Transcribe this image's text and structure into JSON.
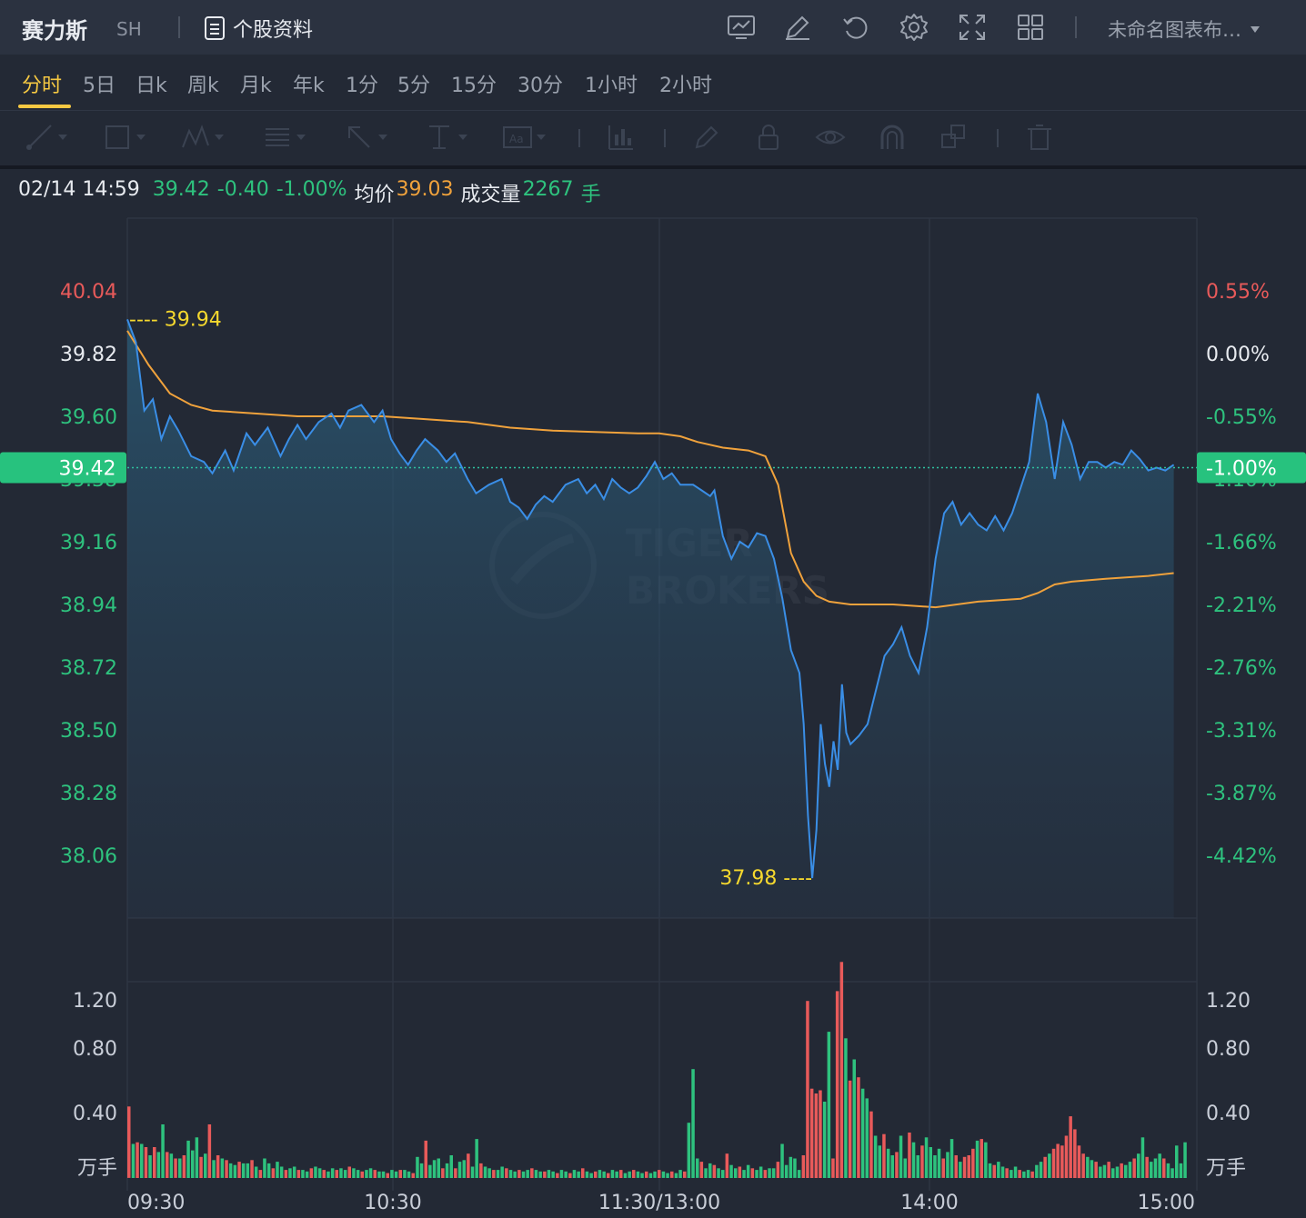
{
  "header": {
    "stock_name": "赛力斯",
    "market": "SH",
    "profile_label": "个股资料",
    "layout_name": "未命名图表布…",
    "icons": [
      "chart-settings-icon",
      "edit-icon",
      "refresh-icon",
      "gear-icon",
      "fullscreen-icon",
      "grid-layout-icon"
    ]
  },
  "periods": [
    "分时",
    "5日",
    "日k",
    "周k",
    "月k",
    "年k",
    "1分",
    "5分",
    "15分",
    "30分",
    "1小时",
    "2小时"
  ],
  "active_period": "分时",
  "drawing_tools": [
    "line-tool-icon",
    "rectangle-tool-icon",
    "pattern-tool-icon",
    "fib-tool-icon",
    "arrow-tool-icon",
    "text-tool-icon",
    "annotation-tool-icon",
    "indicator-icon",
    "brush-icon",
    "lock-icon",
    "eye-icon",
    "magnet-icon",
    "layers-icon",
    "trash-icon"
  ],
  "info": {
    "datetime": "02/14 14:59",
    "price": "39.42",
    "change": "-0.40",
    "change_pct": "-1.00%",
    "avg_label": "均价",
    "avg_value": "39.03",
    "volume_label": "成交量",
    "volume_value": "2267",
    "volume_unit": "手"
  },
  "colors": {
    "up": "#e85a5a",
    "down": "#2ec27e",
    "price_line": "#3a8ee6",
    "avg_line": "#f0a23c",
    "marker": "#f5d82e",
    "background": "#232935"
  },
  "chart_data": {
    "type": "line",
    "x_ticks": [
      "09:30",
      "10:30",
      "11:30/13:00",
      "14:00",
      "15:00"
    ],
    "y_ticks_left": [
      "40.04",
      "39.82",
      "39.60",
      "39.38",
      "39.16",
      "38.94",
      "38.72",
      "38.50",
      "38.28",
      "38.06"
    ],
    "y_ticks_right": [
      "0.55%",
      "0.00%",
      "-0.55%",
      "-1.10%",
      "-1.66%",
      "-2.21%",
      "-2.76%",
      "-3.31%",
      "-3.87%",
      "-4.42%"
    ],
    "ylim": [
      37.8,
      40.3
    ],
    "prev_close": 39.82,
    "current_price": 39.42,
    "current_price_label": "39.42",
    "current_pct_label": "-1.00%",
    "high_label": "39.94",
    "low_label": "37.98",
    "high": 39.94,
    "low": 37.98,
    "price_series": [
      [
        0,
        39.94
      ],
      [
        2,
        39.86
      ],
      [
        4,
        39.62
      ],
      [
        6,
        39.66
      ],
      [
        8,
        39.52
      ],
      [
        10,
        39.6
      ],
      [
        12,
        39.55
      ],
      [
        15,
        39.46
      ],
      [
        18,
        39.44
      ],
      [
        20,
        39.4
      ],
      [
        23,
        39.48
      ],
      [
        25,
        39.41
      ],
      [
        28,
        39.54
      ],
      [
        30,
        39.5
      ],
      [
        33,
        39.56
      ],
      [
        36,
        39.46
      ],
      [
        38,
        39.52
      ],
      [
        40,
        39.57
      ],
      [
        42,
        39.52
      ],
      [
        45,
        39.58
      ],
      [
        48,
        39.61
      ],
      [
        50,
        39.56
      ],
      [
        52,
        39.62
      ],
      [
        55,
        39.64
      ],
      [
        58,
        39.58
      ],
      [
        60,
        39.62
      ],
      [
        62,
        39.52
      ],
      [
        64,
        39.47
      ],
      [
        66,
        39.43
      ],
      [
        68,
        39.48
      ],
      [
        70,
        39.52
      ],
      [
        73,
        39.48
      ],
      [
        75,
        39.44
      ],
      [
        77,
        39.47
      ],
      [
        80,
        39.38
      ],
      [
        82,
        39.33
      ],
      [
        85,
        39.36
      ],
      [
        88,
        39.38
      ],
      [
        90,
        39.3
      ],
      [
        92,
        39.28
      ],
      [
        94,
        39.24
      ],
      [
        96,
        39.29
      ],
      [
        98,
        39.32
      ],
      [
        100,
        39.3
      ],
      [
        103,
        39.36
      ],
      [
        106,
        39.38
      ],
      [
        108,
        39.33
      ],
      [
        110,
        39.36
      ],
      [
        112,
        39.31
      ],
      [
        114,
        39.38
      ],
      [
        116,
        39.35
      ],
      [
        118,
        39.33
      ],
      [
        120,
        39.35
      ],
      [
        122,
        39.39
      ],
      [
        124,
        39.44
      ],
      [
        126,
        39.38
      ],
      [
        128,
        39.4
      ],
      [
        130,
        39.36
      ],
      [
        133,
        39.36
      ],
      [
        135,
        39.34
      ],
      [
        137,
        39.32
      ],
      [
        138,
        39.34
      ],
      [
        140,
        39.18
      ],
      [
        142,
        39.1
      ],
      [
        144,
        39.16
      ],
      [
        146,
        39.14
      ],
      [
        148,
        39.19
      ],
      [
        150,
        39.18
      ],
      [
        152,
        39.1
      ],
      [
        154,
        38.96
      ],
      [
        156,
        38.78
      ],
      [
        158,
        38.7
      ],
      [
        159,
        38.52
      ],
      [
        160,
        38.2
      ],
      [
        161,
        37.98
      ],
      [
        162,
        38.15
      ],
      [
        163,
        38.52
      ],
      [
        164,
        38.38
      ],
      [
        165,
        38.3
      ],
      [
        166,
        38.46
      ],
      [
        167,
        38.36
      ],
      [
        168,
        38.66
      ],
      [
        169,
        38.49
      ],
      [
        170,
        38.45
      ],
      [
        172,
        38.48
      ],
      [
        174,
        38.52
      ],
      [
        176,
        38.64
      ],
      [
        178,
        38.76
      ],
      [
        180,
        38.8
      ],
      [
        182,
        38.86
      ],
      [
        184,
        38.76
      ],
      [
        186,
        38.7
      ],
      [
        188,
        38.86
      ],
      [
        190,
        39.1
      ],
      [
        192,
        39.26
      ],
      [
        194,
        39.3
      ],
      [
        196,
        39.22
      ],
      [
        198,
        39.26
      ],
      [
        200,
        39.22
      ],
      [
        202,
        39.2
      ],
      [
        204,
        39.25
      ],
      [
        206,
        39.2
      ],
      [
        208,
        39.26
      ],
      [
        210,
        39.35
      ],
      [
        212,
        39.44
      ],
      [
        214,
        39.68
      ],
      [
        216,
        39.58
      ],
      [
        218,
        39.38
      ],
      [
        220,
        39.58
      ],
      [
        222,
        39.5
      ],
      [
        224,
        39.38
      ],
      [
        226,
        39.44
      ],
      [
        228,
        39.44
      ],
      [
        230,
        39.42
      ],
      [
        232,
        39.44
      ],
      [
        234,
        39.43
      ],
      [
        236,
        39.48
      ],
      [
        238,
        39.45
      ],
      [
        240,
        39.41
      ],
      [
        242,
        39.42
      ],
      [
        244,
        39.41
      ],
      [
        246,
        39.43
      ],
      [
        240,
        39.42
      ]
    ],
    "avg_series": [
      [
        0,
        39.9
      ],
      [
        5,
        39.78
      ],
      [
        10,
        39.68
      ],
      [
        15,
        39.64
      ],
      [
        20,
        39.62
      ],
      [
        30,
        39.61
      ],
      [
        40,
        39.6
      ],
      [
        60,
        39.6
      ],
      [
        70,
        39.59
      ],
      [
        80,
        39.58
      ],
      [
        90,
        39.56
      ],
      [
        100,
        39.55
      ],
      [
        120,
        39.54
      ],
      [
        125,
        39.54
      ],
      [
        130,
        39.53
      ],
      [
        134,
        39.51
      ],
      [
        140,
        39.49
      ],
      [
        146,
        39.48
      ],
      [
        150,
        39.46
      ],
      [
        153,
        39.36
      ],
      [
        156,
        39.12
      ],
      [
        159,
        39.02
      ],
      [
        162,
        38.97
      ],
      [
        165,
        38.95
      ],
      [
        170,
        38.94
      ],
      [
        180,
        38.94
      ],
      [
        190,
        38.93
      ],
      [
        200,
        38.95
      ],
      [
        210,
        38.96
      ],
      [
        214,
        38.98
      ],
      [
        218,
        39.01
      ],
      [
        222,
        39.02
      ],
      [
        230,
        39.03
      ],
      [
        240,
        39.04
      ],
      [
        246,
        39.05
      ]
    ],
    "x_total": 248,
    "volume_ticks": [
      "1.20",
      "0.80",
      "0.40"
    ],
    "volume_unit": "万手",
    "volume_ylim": [
      0,
      1.6
    ],
    "volume_series": [
      0.44,
      0.21,
      0.22,
      0.21,
      0.19,
      0.14,
      0.19,
      0.16,
      0.33,
      0.16,
      0.15,
      0.12,
      0.12,
      0.14,
      0.23,
      0.17,
      0.25,
      0.13,
      0.15,
      0.33,
      0.11,
      0.14,
      0.12,
      0.11,
      0.09,
      0.08,
      0.1,
      0.09,
      0.09,
      0.11,
      0.07,
      0.05,
      0.12,
      0.09,
      0.06,
      0.1,
      0.07,
      0.05,
      0.06,
      0.07,
      0.05,
      0.05,
      0.04,
      0.06,
      0.07,
      0.06,
      0.05,
      0.04,
      0.06,
      0.05,
      0.06,
      0.05,
      0.07,
      0.06,
      0.05,
      0.04,
      0.05,
      0.06,
      0.05,
      0.04,
      0.04,
      0.03,
      0.05,
      0.04,
      0.05,
      0.05,
      0.04,
      0.03,
      0.13,
      0.09,
      0.23,
      0.08,
      0.11,
      0.12,
      0.06,
      0.09,
      0.14,
      0.06,
      0.1,
      0.11,
      0.15,
      0.07,
      0.24,
      0.09,
      0.07,
      0.06,
      0.05,
      0.05,
      0.07,
      0.06,
      0.05,
      0.04,
      0.05,
      0.04,
      0.05,
      0.06,
      0.05,
      0.04,
      0.04,
      0.05,
      0.04,
      0.03,
      0.05,
      0.04,
      0.03,
      0.05,
      0.04,
      0.06,
      0.04,
      0.03,
      0.04,
      0.05,
      0.04,
      0.03,
      0.05,
      0.04,
      0.05,
      0.03,
      0.04,
      0.05,
      0.04,
      0.03,
      0.04,
      0.03,
      0.04,
      0.05,
      0.04,
      0.03,
      0.04,
      0.03,
      0.05,
      0.04,
      0.34,
      0.67,
      0.12,
      0.1,
      0.06,
      0.09,
      0.08,
      0.06,
      0.05,
      0.15,
      0.08,
      0.06,
      0.07,
      0.05,
      0.08,
      0.06,
      0.05,
      0.07,
      0.05,
      0.06,
      0.06,
      0.1,
      0.21,
      0.08,
      0.13,
      0.12,
      0.05,
      0.14,
      1.09,
      0.55,
      0.52,
      0.54,
      0.47,
      0.9,
      0.12,
      1.15,
      1.33,
      0.86,
      0.6,
      0.73,
      0.62,
      0.55,
      0.49,
      0.41,
      0.26,
      0.2,
      0.27,
      0.18,
      0.14,
      0.16,
      0.26,
      0.12,
      0.28,
      0.22,
      0.14,
      0.2,
      0.25,
      0.19,
      0.14,
      0.18,
      0.12,
      0.16,
      0.24,
      0.14,
      0.1,
      0.13,
      0.14,
      0.18,
      0.23,
      0.24,
      0.22,
      0.09,
      0.08,
      0.1,
      0.07,
      0.06,
      0.05,
      0.07,
      0.05,
      0.04,
      0.05,
      0.04,
      0.08,
      0.1,
      0.13,
      0.15,
      0.18,
      0.21,
      0.2,
      0.26,
      0.38,
      0.3,
      0.2,
      0.15,
      0.13,
      0.11,
      0.1,
      0.07,
      0.08,
      0.1,
      0.06,
      0.07,
      0.09,
      0.08,
      0.1,
      0.12,
      0.15,
      0.25,
      0.13,
      0.1,
      0.12,
      0.15,
      0.12,
      0.09,
      0.06,
      0.2,
      0.09,
      0.22
    ],
    "volume_colors": "mixed red/green by price direction"
  }
}
